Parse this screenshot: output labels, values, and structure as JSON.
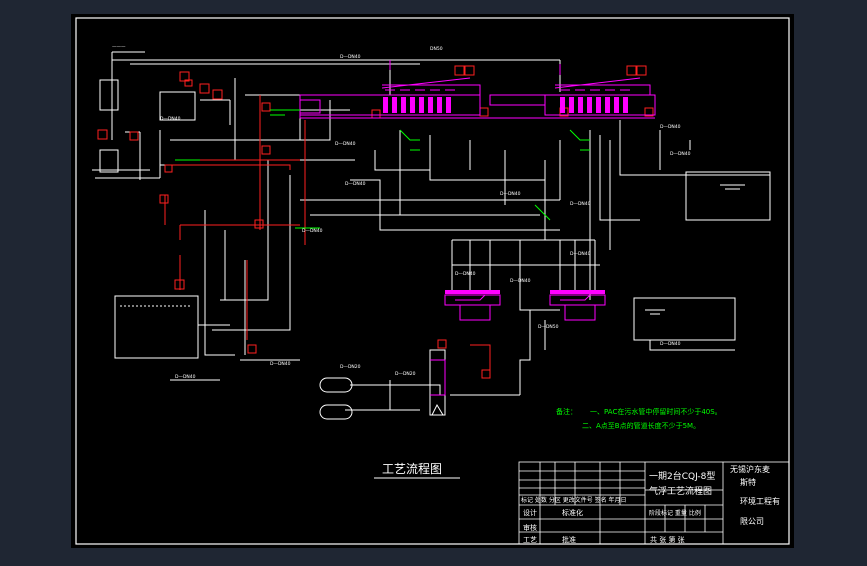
{
  "drawing": {
    "title": "工艺流程图",
    "notes_label": "备注：",
    "note_1": "一、PAC在污水管中停留时间不少于40S。",
    "note_2": "二、A点至B点的管道长度不少于5M。"
  },
  "title_block": {
    "drawing_name_line1": "一期2台CQJ-8型",
    "drawing_name_line2": "气浮工艺流程图",
    "company_line1": "无锡沪东麦",
    "company_line2": "斯特",
    "company_line3": "环境工程有",
    "company_line4": "限公司",
    "revision_header": "标记 处数 分区 更改文件号 签名 年月日",
    "design_row": "设计",
    "standardize": "标准化",
    "stage_labels": "阶段标记 重量 比例",
    "review": "审核",
    "process": "工艺",
    "approve": "批准",
    "sheet_info": "共 张 第 张"
  },
  "colors": {
    "background": "#000000",
    "frame": "#ffffff",
    "magenta": "#ff00ff",
    "red": "#ff2020",
    "green": "#00ff00",
    "yellow": "#ffff00",
    "viewer_bg": "#1f2633"
  }
}
